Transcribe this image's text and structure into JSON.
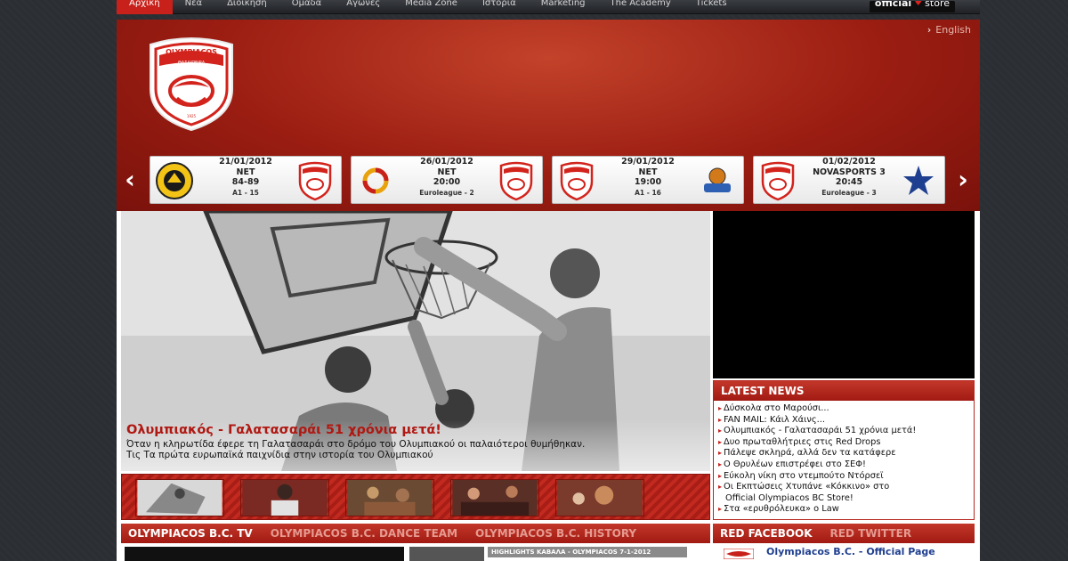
{
  "topnav": {
    "items": [
      "Αρχική",
      "Νέα",
      "Διοίκηση",
      "Ομάδα",
      "Αγώνες",
      "Media Zone",
      "Ιστορία",
      "Marketing",
      "The Academy",
      "Tickets"
    ],
    "store": {
      "word1": "official",
      "word2": "store"
    }
  },
  "header": {
    "lang_link": "English",
    "logo_text": "OLYMPIACOS ΘΑΣΑΙΠΕΙΡΑ"
  },
  "fixtures": [
    {
      "date": "21/01/2012",
      "channel": "NET",
      "score_time": "84-89",
      "comp": "Α1 - 15"
    },
    {
      "date": "26/01/2012",
      "channel": "NET",
      "score_time": "20:00",
      "comp": "Euroleague - 2"
    },
    {
      "date": "29/01/2012",
      "channel": "NET",
      "score_time": "19:00",
      "comp": "Α1 - 16"
    },
    {
      "date": "01/02/2012",
      "channel": "NOVASPORTS 3",
      "score_time": "20:45",
      "comp": "Euroleague - 3"
    }
  ],
  "hero": {
    "title": "Ολυμπιακός - Γαλατασαράι 51 χρόνια μετά!",
    "desc_line1": "Όταν η κληρωτίδα έφερε τη Γαλατασαράι στο δρόμο του Ολυμπιακού οι παλαιότεροι θυμήθηκαν.",
    "desc_line2": "Τις Τα πρώτα ευρωπαϊκά παιχνίδια στην ιστορία του Ολυμπιακού"
  },
  "latest_news": {
    "header": "LATEST NEWS",
    "items": [
      "Δύσκολα στο Μαρούσι...",
      "FAN MAIL: Κάιλ Χάινς...",
      "Ολυμπιακός - Γαλατασαράι 51 χρόνια μετά!",
      "Δυο πρωταθλήτριες στις Red Drops",
      "Πάλεψε σκληρά, αλλά δεν τα κατάφερε",
      "Ο Θρυλέων επιστρέφει στο ΣΕΦ!",
      "Εύκολη νίκη στο ντεμπούτο Ντόρσεϊ",
      "Οι Εκπτώσεις Χτυπάνε «Κόκκινο» στο",
      "Official Olympiacos BC Store!",
      "Στα «ερυθρόλευκα» ο Law"
    ]
  },
  "bottom_tabs": [
    "OLYMPIACOS B.C. TV",
    "OLYMPIACOS B.C. DANCE TEAM",
    "OLYMPIACOS B.C. HISTORY"
  ],
  "tv_label": "HIGHLIGHTS ΚΑΒΑΛΑ - OLYMPIACOS 7-1-2012",
  "social_tabs": [
    "RED FACEBOOK",
    "RED TWITTER"
  ],
  "facebook": {
    "page_title": "Olympiacos B.C. - Official Page"
  },
  "colors": {
    "brand_red": "#c8201a",
    "dark_red": "#7a120b",
    "bg": "#2b2e33"
  }
}
